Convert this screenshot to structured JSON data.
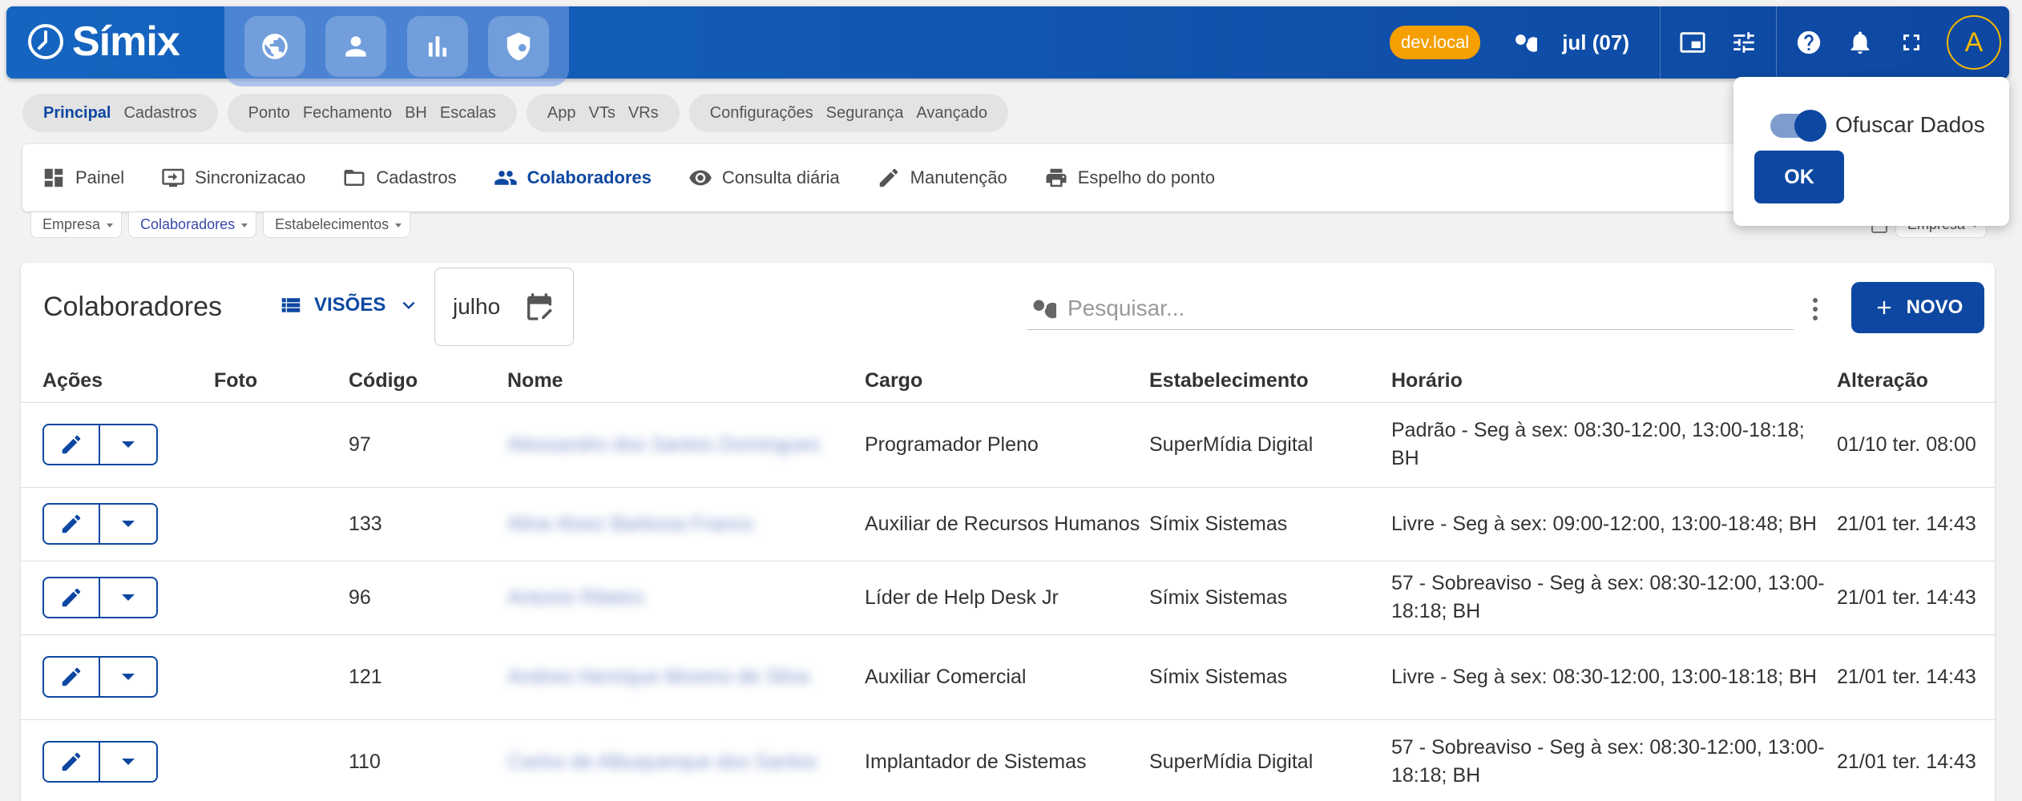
{
  "app": {
    "brand": "Símix",
    "env_badge": "dev.local",
    "period": "jul (07)",
    "avatar_letter": "A",
    "colors": {
      "primary": "#0d47a1",
      "env": "#f59f00",
      "avatar": "#f5b800"
    }
  },
  "modules": [
    "globe-icon",
    "person-icon",
    "bar-chart-icon",
    "shield-icon"
  ],
  "menu_groups": [
    {
      "items": [
        "Principal",
        "Cadastros"
      ],
      "active": "Principal"
    },
    {
      "items": [
        "Ponto",
        "Fechamento",
        "BH",
        "Escalas"
      ]
    },
    {
      "items": [
        "App",
        "VTs",
        "VRs"
      ]
    },
    {
      "items": [
        "Configurações",
        "Segurança",
        "Avançado"
      ]
    }
  ],
  "subnav": [
    {
      "label": "Painel",
      "icon": "dashboard-icon"
    },
    {
      "label": "Sincronizacao",
      "icon": "sync-icon"
    },
    {
      "label": "Cadastros",
      "icon": "folder-icon"
    },
    {
      "label": "Colaboradores",
      "icon": "people-icon",
      "active": true
    },
    {
      "label": "Consulta diária",
      "icon": "eye-icon"
    },
    {
      "label": "Manutenção",
      "icon": "pencil-icon"
    },
    {
      "label": "Espelho do ponto",
      "icon": "printer-icon"
    }
  ],
  "filters": [
    {
      "label": "Empresa"
    },
    {
      "label": "Colaboradores",
      "active": true
    },
    {
      "label": "Estabelecimentos"
    }
  ],
  "filter_right": {
    "label": "Empresa"
  },
  "main": {
    "title": "Colaboradores",
    "views_label": "VISÕES",
    "month": "julho",
    "search_placeholder": "Pesquisar...",
    "new_label": "NOVO"
  },
  "table": {
    "columns": [
      "Ações",
      "Foto",
      "Código",
      "Nome",
      "Cargo",
      "Estabelecimento",
      "Horário",
      "Alteração"
    ],
    "rows": [
      {
        "codigo": "97",
        "nome": "Alessandro dos Santos Domingues",
        "cargo": "Programador Pleno",
        "estabelecimento": "SuperMídia Digital",
        "horario": "Padrão - Seg à sex: 08:30-12:00, 13:00-18:18; BH",
        "alteracao": "01/10 ter. 08:00"
      },
      {
        "codigo": "133",
        "nome": "Aline Alvez Barbosa Franco",
        "cargo": "Auxiliar de Recursos Humanos",
        "estabelecimento": "Símix Sistemas",
        "horario": "Livre - Seg à sex: 09:00-12:00, 13:00-18:48; BH",
        "alteracao": "21/01 ter. 14:43"
      },
      {
        "codigo": "96",
        "nome": "Antonio Ribeiro",
        "cargo": "Líder de Help Desk Jr",
        "estabelecimento": "Símix Sistemas",
        "horario": "57 - Sobreaviso - Seg à sex: 08:30-12:00, 13:00-18:18; BH",
        "alteracao": "21/01 ter. 14:43"
      },
      {
        "codigo": "121",
        "nome": "Andrea Henrique Moreno de Silva",
        "cargo": "Auxiliar Comercial",
        "estabelecimento": "Símix Sistemas",
        "horario": "Livre - Seg à sex: 08:30-12:00, 13:00-18:18; BH",
        "alteracao": "21/01 ter. 14:43"
      },
      {
        "codigo": "110",
        "nome": "Carlos de Albuquerque dos Santos",
        "cargo": "Implantador de Sistemas",
        "estabelecimento": "SuperMídia Digital",
        "horario": "57 - Sobreaviso - Seg à sex: 08:30-12:00, 13:00-18:18; BH",
        "alteracao": "21/01 ter. 14:43"
      }
    ]
  },
  "popover": {
    "toggle_label": "Ofuscar Dados",
    "toggle_on": true,
    "ok_label": "OK"
  }
}
